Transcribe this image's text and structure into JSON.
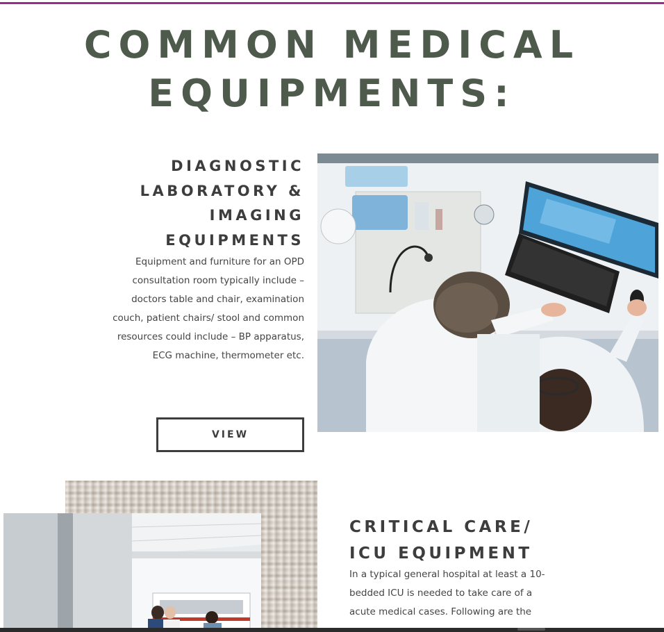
{
  "page": {
    "title_lines": [
      "COMMON MEDICAL",
      "EQUIPMENTS:"
    ]
  },
  "diagnostic": {
    "heading_lines": [
      "DIAGNOSTIC",
      "LABORATORY &",
      "IMAGING",
      "EQUIPMENTS"
    ],
    "body_lines": [
      "Equipment and furniture for an OPD",
      "consultation room typically include –",
      "doctors table and chair, examination",
      "couch, patient chairs/ stool and common",
      "resources could include – BP apparatus,",
      "ECG machine, thermometer etc."
    ],
    "button_label": "VIEW"
  },
  "critical_care": {
    "heading_lines": [
      "CRITICAL CARE/",
      "ICU EQUIPMENT"
    ],
    "body_lines": [
      "In a typical general hospital at least a 10-",
      "bedded ICU is needed to take care of a",
      "acute medical cases. Following are the"
    ]
  },
  "colors": {
    "accent_rule": "#9b2a8f",
    "title_green": "#4e5b4c",
    "heading_dark": "#3d3d3d"
  }
}
